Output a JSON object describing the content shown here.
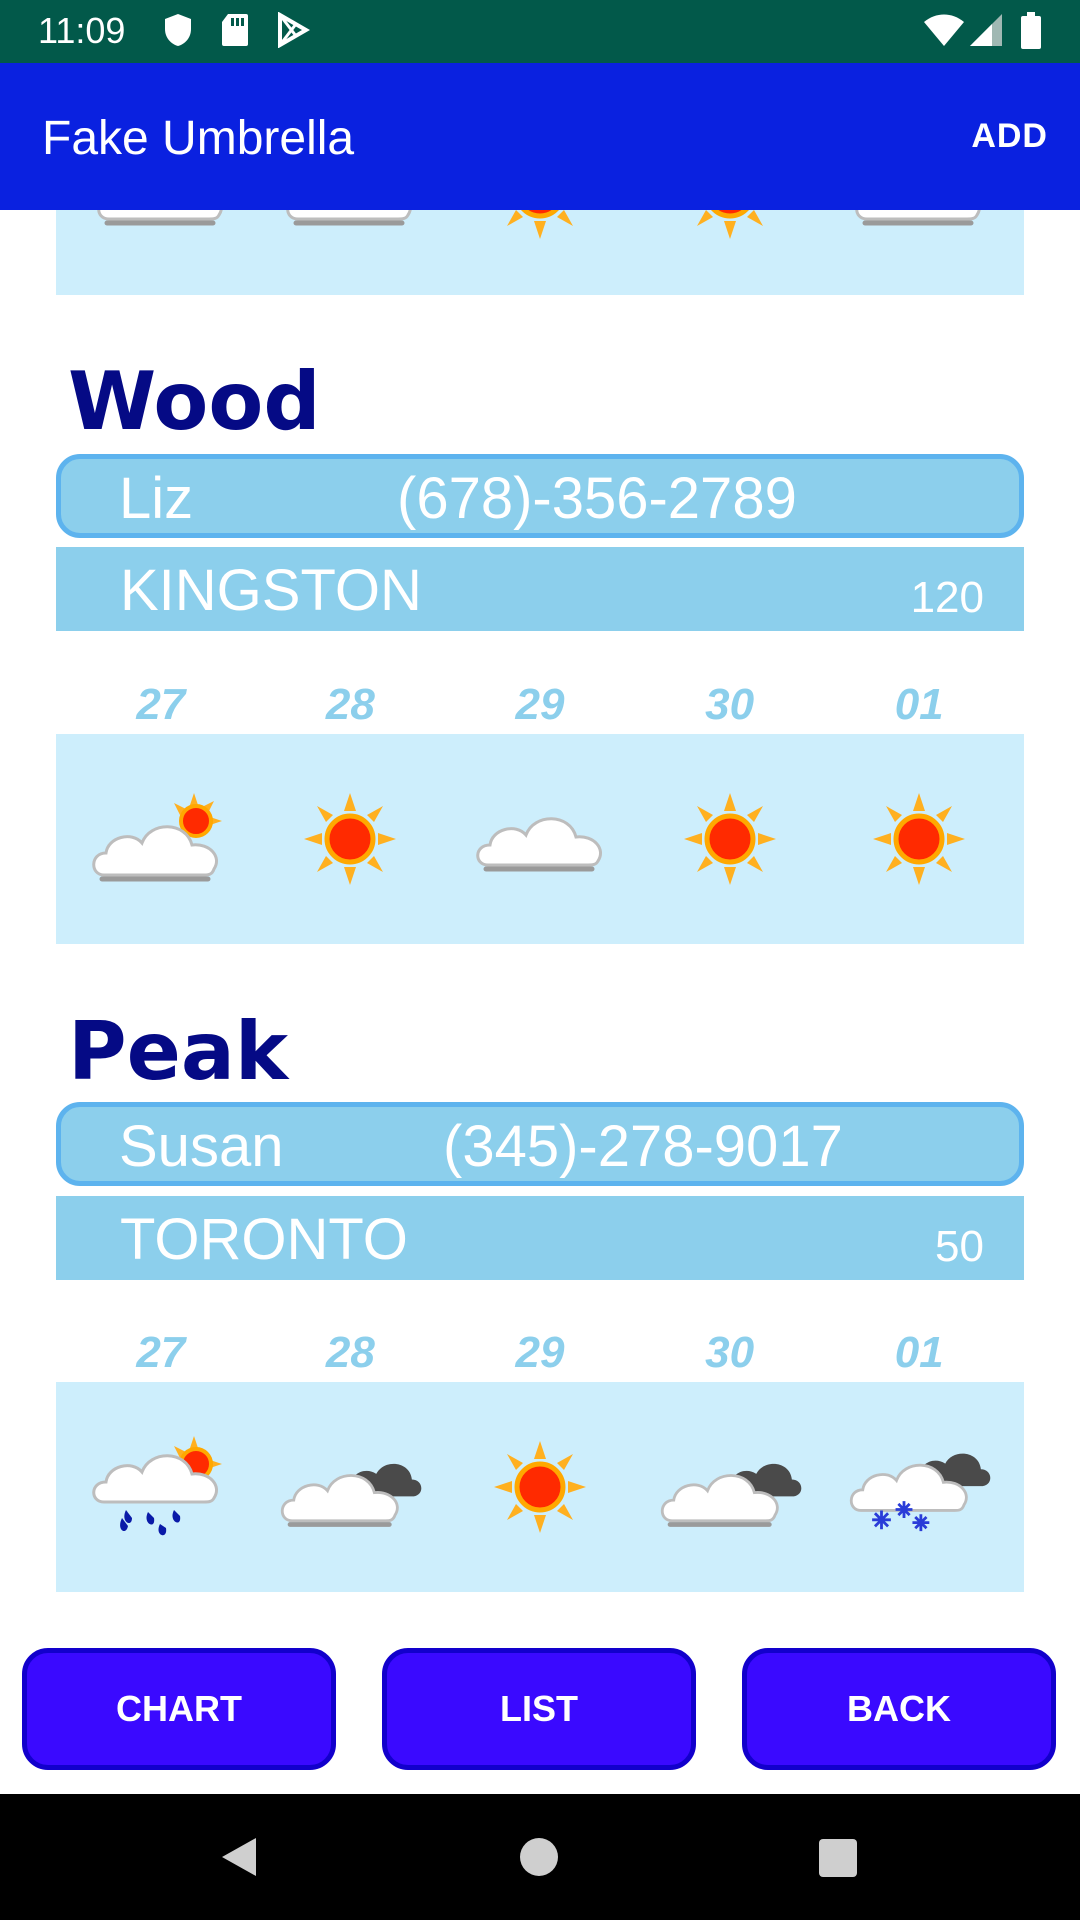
{
  "status_bar": {
    "time": "11:09",
    "icons": [
      "shield-icon",
      "sd-card-icon",
      "play-store-icon",
      "wifi-icon",
      "signal-icon",
      "battery-icon"
    ]
  },
  "app_bar": {
    "title": "Fake Umbrella",
    "action": "ADD"
  },
  "partial_section": {
    "icons": [
      "cloud-icon",
      "cloud-icon",
      "sun-icon",
      "sun-icon",
      "cloud-icon"
    ]
  },
  "sections": [
    {
      "title": "Wood",
      "contact_name": "Liz",
      "phone": "(678)-356-2789",
      "city": "KINGSTON",
      "value": "120",
      "dates": [
        "27",
        "28",
        "29",
        "30",
        "01"
      ],
      "icons": [
        "cloud-sun-icon",
        "sun-icon",
        "cloud-icon",
        "sun-icon",
        "sun-icon"
      ]
    },
    {
      "title": "Peak",
      "contact_name": "Susan",
      "phone": "(345)-278-9017",
      "city": "TORONTO",
      "value": "50",
      "dates": [
        "27",
        "28",
        "29",
        "30",
        "01"
      ],
      "icons": [
        "rain-sun-icon",
        "cloud-dark-icon",
        "sun-icon",
        "cloud-dark-icon",
        "snow-cloud-icon"
      ]
    }
  ],
  "buttons": {
    "chart": "CHART",
    "list": "LIST",
    "back": "BACK"
  },
  "colors": {
    "status_bar": "#02594a",
    "app_bar": "#0a21e0",
    "button": "#3a09ff",
    "title": "#050a85",
    "contact_bg": "#8ccfec",
    "panel_bg": "#cdeefc"
  }
}
